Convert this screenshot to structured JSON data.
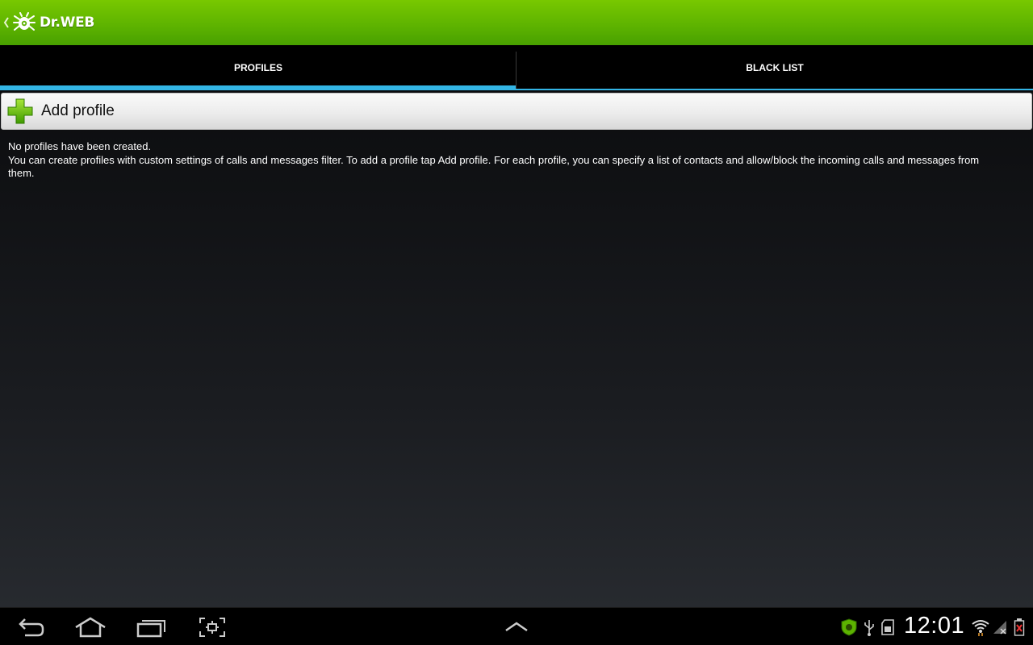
{
  "app": {
    "brand": "Dr.WEB",
    "colors": {
      "action_bar": "#5cb200",
      "tab_indicator": "#33b5e5"
    }
  },
  "tabs": [
    {
      "label": "PROFILES",
      "selected": true
    },
    {
      "label": "BLACK LIST",
      "selected": false
    }
  ],
  "content": {
    "add_profile_label": "Add profile",
    "empty_title": "No profiles have been created.",
    "empty_body": "You can create profiles with custom settings of calls and messages filter. To add a profile tap Add profile. For each profile, you can specify a list of contacts and allow/block the incoming calls and messages from them."
  },
  "system_bar": {
    "time": "12:01",
    "nav_icons": [
      "back-icon",
      "home-icon",
      "recent-apps-icon",
      "screenshot-icon",
      "chevron-up-icon"
    ],
    "status_icons": [
      "drweb-shield-icon",
      "usb-icon",
      "sd-card-icon",
      "wifi-icon",
      "signal-icon",
      "battery-icon"
    ]
  }
}
